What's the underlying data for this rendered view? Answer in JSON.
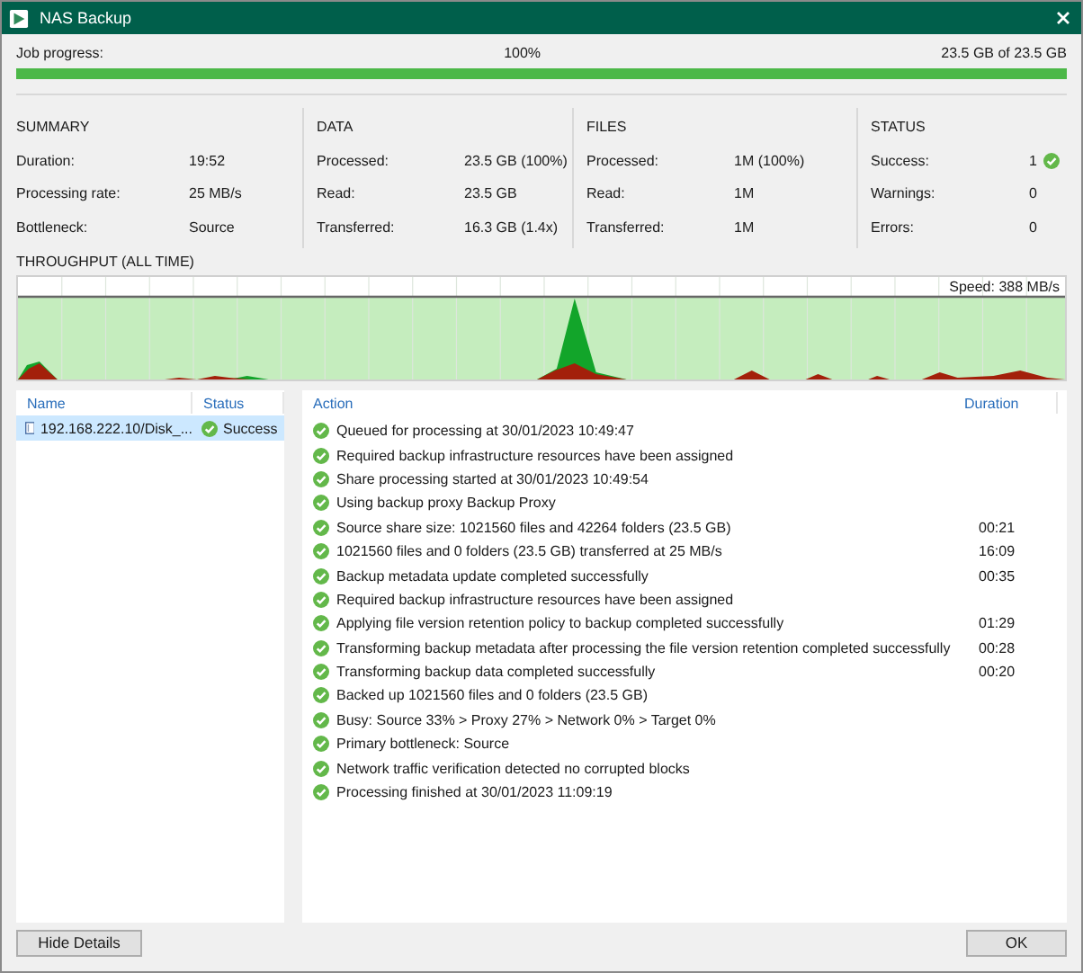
{
  "window": {
    "title": "NAS Backup"
  },
  "progress": {
    "label": "Job progress:",
    "percent": "100%",
    "amount": "23.5 GB of 23.5 GB",
    "level": 1
  },
  "sections": [
    {
      "title": "SUMMARY",
      "rows": [
        {
          "label": "Duration:",
          "value": "19:52"
        },
        {
          "label": "Processing rate:",
          "value": "25 MB/s"
        },
        {
          "label": "Bottleneck:",
          "value": "Source"
        }
      ]
    },
    {
      "title": "DATA",
      "rows": [
        {
          "label": "Processed:",
          "value": "23.5 GB (100%)"
        },
        {
          "label": "Read:",
          "value": "23.5 GB"
        },
        {
          "label": "Transferred:",
          "value": "16.3 GB (1.4x)"
        }
      ]
    },
    {
      "title": "FILES",
      "rows": [
        {
          "label": "Processed:",
          "value": "1M (100%)"
        },
        {
          "label": "Read:",
          "value": "1M"
        },
        {
          "label": "Transferred:",
          "value": "1M"
        }
      ]
    },
    {
      "title": "STATUS",
      "rows": [
        {
          "label": "Success:",
          "value": "1",
          "kind": "success"
        },
        {
          "label": "Warnings:",
          "value": "0",
          "kind": "plain"
        },
        {
          "label": "Errors:",
          "value": "0",
          "kind": "plain"
        }
      ]
    }
  ],
  "throughput": {
    "title": "THROUGHPUT (ALL TIME)",
    "speed": "Speed: 388 MB/s"
  },
  "objects": {
    "columns": [
      "Name",
      "Status"
    ],
    "rows": [
      {
        "name": "192.168.222.10/Disk_...",
        "status": "Success",
        "selected": true
      }
    ]
  },
  "actions": {
    "columns": [
      "Action",
      "Duration"
    ],
    "rows": [
      {
        "text": "Queued for processing at 30/01/2023 10:49:47",
        "kind": "success"
      },
      {
        "text": "Required backup infrastructure resources have been assigned",
        "kind": "success"
      },
      {
        "text": "Share processing started at 30/01/2023 10:49:54",
        "kind": "success"
      },
      {
        "text": "Using backup proxy Backup Proxy",
        "kind": "success"
      },
      {
        "text": "Source share size: 1021560 files and 42264 folders (23.5 GB)",
        "duration": "00:21",
        "kind": "success"
      },
      {
        "text": "1021560 files and 0 folders (23.5 GB) transferred at 25 MB/s",
        "duration": "16:09",
        "kind": "success"
      },
      {
        "text": "Backup metadata update completed successfully",
        "duration": "00:35",
        "kind": "success"
      },
      {
        "text": "Required backup infrastructure resources have been assigned",
        "kind": "success"
      },
      {
        "text": "Applying file version retention policy to backup completed successfully",
        "duration": "01:29",
        "kind": "success"
      },
      {
        "text": "Transforming backup metadata after processing the file version retention completed successfully",
        "duration": "00:28",
        "kind": "success"
      },
      {
        "text": "Transforming backup data completed successfully",
        "duration": "00:20",
        "kind": "success"
      },
      {
        "text": "Backed up 1021560 files and 0 folders (23.5 GB)",
        "kind": "success"
      },
      {
        "text": "Busy: Source 33% > Proxy 27% > Network 0% > Target 0%",
        "kind": "success"
      },
      {
        "text": "Primary bottleneck: Source",
        "kind": "success"
      },
      {
        "text": "Network traffic verification detected no corrupted blocks",
        "kind": "success"
      },
      {
        "text": "Processing finished at 30/01/2023 11:09:19",
        "kind": "success"
      }
    ]
  },
  "buttons": [
    {
      "label": "Hide Details"
    },
    {
      "label": "OK"
    }
  ]
}
